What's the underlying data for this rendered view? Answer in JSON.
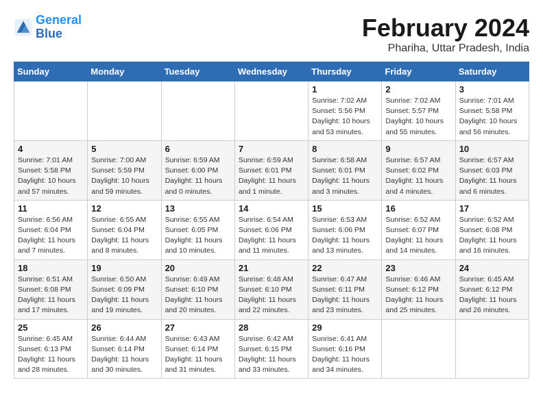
{
  "header": {
    "logo_line1": "General",
    "logo_line2": "Blue",
    "month_title": "February 2024",
    "subtitle": "Phariha, Uttar Pradesh, India"
  },
  "days_of_week": [
    "Sunday",
    "Monday",
    "Tuesday",
    "Wednesday",
    "Thursday",
    "Friday",
    "Saturday"
  ],
  "weeks": [
    [
      {
        "day": "",
        "info": ""
      },
      {
        "day": "",
        "info": ""
      },
      {
        "day": "",
        "info": ""
      },
      {
        "day": "",
        "info": ""
      },
      {
        "day": "1",
        "info": "Sunrise: 7:02 AM\nSunset: 5:56 PM\nDaylight: 10 hours and 53 minutes."
      },
      {
        "day": "2",
        "info": "Sunrise: 7:02 AM\nSunset: 5:57 PM\nDaylight: 10 hours and 55 minutes."
      },
      {
        "day": "3",
        "info": "Sunrise: 7:01 AM\nSunset: 5:58 PM\nDaylight: 10 hours and 56 minutes."
      }
    ],
    [
      {
        "day": "4",
        "info": "Sunrise: 7:01 AM\nSunset: 5:58 PM\nDaylight: 10 hours and 57 minutes."
      },
      {
        "day": "5",
        "info": "Sunrise: 7:00 AM\nSunset: 5:59 PM\nDaylight: 10 hours and 59 minutes."
      },
      {
        "day": "6",
        "info": "Sunrise: 6:59 AM\nSunset: 6:00 PM\nDaylight: 11 hours and 0 minutes."
      },
      {
        "day": "7",
        "info": "Sunrise: 6:59 AM\nSunset: 6:01 PM\nDaylight: 11 hours and 1 minute."
      },
      {
        "day": "8",
        "info": "Sunrise: 6:58 AM\nSunset: 6:01 PM\nDaylight: 11 hours and 3 minutes."
      },
      {
        "day": "9",
        "info": "Sunrise: 6:57 AM\nSunset: 6:02 PM\nDaylight: 11 hours and 4 minutes."
      },
      {
        "day": "10",
        "info": "Sunrise: 6:57 AM\nSunset: 6:03 PM\nDaylight: 11 hours and 6 minutes."
      }
    ],
    [
      {
        "day": "11",
        "info": "Sunrise: 6:56 AM\nSunset: 6:04 PM\nDaylight: 11 hours and 7 minutes."
      },
      {
        "day": "12",
        "info": "Sunrise: 6:55 AM\nSunset: 6:04 PM\nDaylight: 11 hours and 8 minutes."
      },
      {
        "day": "13",
        "info": "Sunrise: 6:55 AM\nSunset: 6:05 PM\nDaylight: 11 hours and 10 minutes."
      },
      {
        "day": "14",
        "info": "Sunrise: 6:54 AM\nSunset: 6:06 PM\nDaylight: 11 hours and 11 minutes."
      },
      {
        "day": "15",
        "info": "Sunrise: 6:53 AM\nSunset: 6:06 PM\nDaylight: 11 hours and 13 minutes."
      },
      {
        "day": "16",
        "info": "Sunrise: 6:52 AM\nSunset: 6:07 PM\nDaylight: 11 hours and 14 minutes."
      },
      {
        "day": "17",
        "info": "Sunrise: 6:52 AM\nSunset: 6:08 PM\nDaylight: 11 hours and 16 minutes."
      }
    ],
    [
      {
        "day": "18",
        "info": "Sunrise: 6:51 AM\nSunset: 6:08 PM\nDaylight: 11 hours and 17 minutes."
      },
      {
        "day": "19",
        "info": "Sunrise: 6:50 AM\nSunset: 6:09 PM\nDaylight: 11 hours and 19 minutes."
      },
      {
        "day": "20",
        "info": "Sunrise: 6:49 AM\nSunset: 6:10 PM\nDaylight: 11 hours and 20 minutes."
      },
      {
        "day": "21",
        "info": "Sunrise: 6:48 AM\nSunset: 6:10 PM\nDaylight: 11 hours and 22 minutes."
      },
      {
        "day": "22",
        "info": "Sunrise: 6:47 AM\nSunset: 6:11 PM\nDaylight: 11 hours and 23 minutes."
      },
      {
        "day": "23",
        "info": "Sunrise: 6:46 AM\nSunset: 6:12 PM\nDaylight: 11 hours and 25 minutes."
      },
      {
        "day": "24",
        "info": "Sunrise: 6:45 AM\nSunset: 6:12 PM\nDaylight: 11 hours and 26 minutes."
      }
    ],
    [
      {
        "day": "25",
        "info": "Sunrise: 6:45 AM\nSunset: 6:13 PM\nDaylight: 11 hours and 28 minutes."
      },
      {
        "day": "26",
        "info": "Sunrise: 6:44 AM\nSunset: 6:14 PM\nDaylight: 11 hours and 30 minutes."
      },
      {
        "day": "27",
        "info": "Sunrise: 6:43 AM\nSunset: 6:14 PM\nDaylight: 11 hours and 31 minutes."
      },
      {
        "day": "28",
        "info": "Sunrise: 6:42 AM\nSunset: 6:15 PM\nDaylight: 11 hours and 33 minutes."
      },
      {
        "day": "29",
        "info": "Sunrise: 6:41 AM\nSunset: 6:16 PM\nDaylight: 11 hours and 34 minutes."
      },
      {
        "day": "",
        "info": ""
      },
      {
        "day": "",
        "info": ""
      }
    ]
  ]
}
